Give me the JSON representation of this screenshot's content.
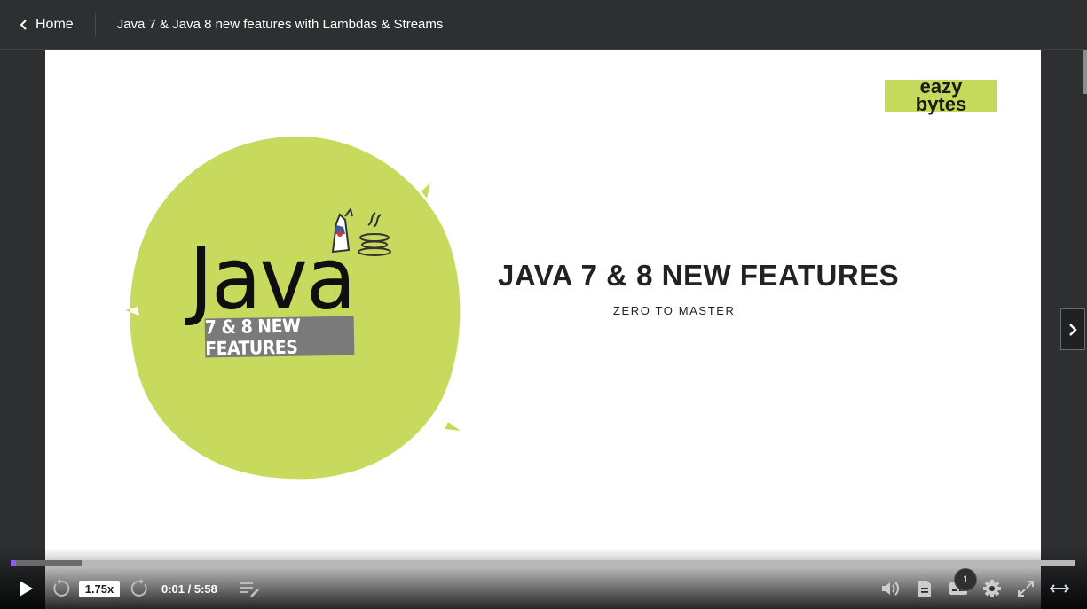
{
  "header": {
    "back_label": "Home",
    "course_title": "Java 7 & Java 8 new features with Lambdas & Streams"
  },
  "slide": {
    "logo_word": "Java",
    "logo_banner": "7 & 8 NEW FEATURES",
    "headline": "JAVA 7 & 8 NEW FEATURES",
    "subheadline": "ZERO TO MASTER",
    "brand_line1": "eazy",
    "brand_line2": "bytes",
    "accent_color": "#c5d95a"
  },
  "player": {
    "playback_speed": "1.75x",
    "time_display": "0:01 / 5:58",
    "progress_fraction": 0.003,
    "buffered_fraction": 0.067,
    "captions_badge": "1",
    "progress_color": "#8b5cf6",
    "icons": [
      "play-icon",
      "rewind-5-icon",
      "forward-5-icon",
      "playlist-icon",
      "volume-icon",
      "transcript-icon",
      "captions-icon",
      "settings-icon",
      "fullscreen-icon",
      "expand-icon",
      "chevron-right-icon",
      "chevron-left-icon"
    ]
  }
}
